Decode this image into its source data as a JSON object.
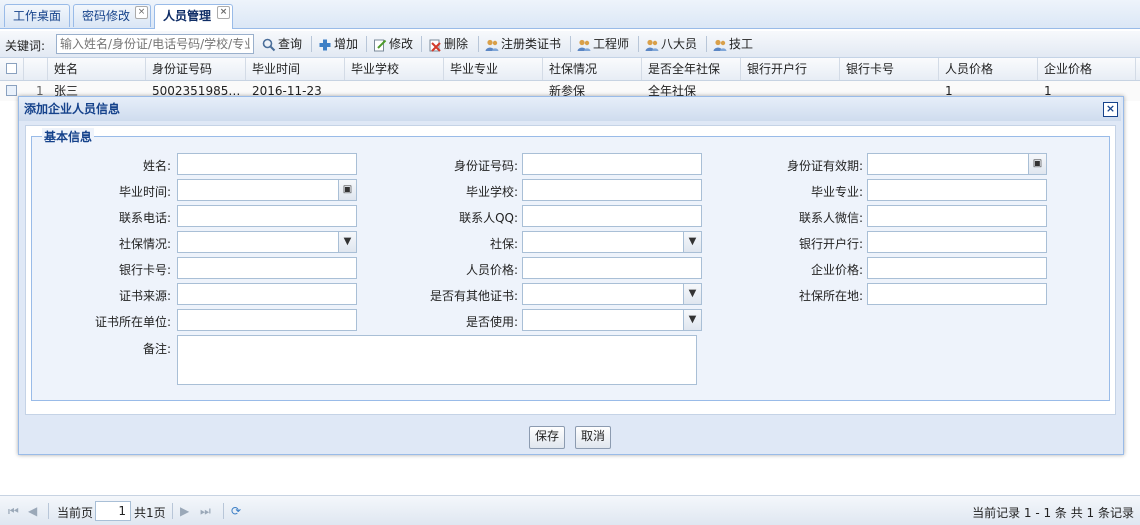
{
  "tabs": [
    {
      "label": "工作桌面"
    },
    {
      "label": "密码修改"
    },
    {
      "label": "人员管理"
    }
  ],
  "toolbar": {
    "keyword_label": "关键词:",
    "search_placeholder": "输入姓名/身份证/电话号码/学校/专业",
    "buttons": [
      {
        "label": "查询",
        "icon": "search-icon"
      },
      {
        "label": "增加",
        "icon": "add-icon"
      },
      {
        "label": "修改",
        "icon": "edit-icon"
      },
      {
        "label": "删除",
        "icon": "delete-icon"
      },
      {
        "label": "注册类证书",
        "icon": "users-icon"
      },
      {
        "label": "工程师",
        "icon": "users-icon"
      },
      {
        "label": "八大员",
        "icon": "users-icon"
      },
      {
        "label": "技工",
        "icon": "users-icon"
      }
    ]
  },
  "grid": {
    "columns": [
      "姓名",
      "身份证号码",
      "毕业时间",
      "毕业学校",
      "毕业专业",
      "社保情况",
      "是否全年社保",
      "银行开户行",
      "银行卡号",
      "人员价格",
      "企业价格"
    ],
    "rows": [
      {
        "num": "1",
        "cells": [
          "张三",
          "5002351985…",
          "2016-11-23",
          "",
          "",
          "新参保",
          "全年社保",
          "",
          "",
          "1",
          "1"
        ]
      }
    ]
  },
  "dialog": {
    "title": "添加企业人员信息",
    "legend": "基本信息",
    "fields": {
      "name": "姓名:",
      "id_number": "身份证号码:",
      "id_valid": "身份证有效期:",
      "grad_time": "毕业时间:",
      "grad_school": "毕业学校:",
      "grad_major": "毕业专业:",
      "phone": "联系电话:",
      "qq": "联系人QQ:",
      "wechat": "联系人微信:",
      "social_status": "社保情况:",
      "social": "社保:",
      "bank": "银行开户行:",
      "card": "银行卡号:",
      "person_price": "人员价格:",
      "company_price": "企业价格:",
      "cert_source": "证书来源:",
      "other_cert": "是否有其他证书:",
      "social_loc": "社保所在地:",
      "cert_unit": "证书所在单位:",
      "in_use": "是否使用:",
      "remark": "备注:"
    },
    "save": "保存",
    "cancel": "取消"
  },
  "pager": {
    "current_label": "当前页",
    "page_value": "1",
    "total_pages": "共1页",
    "summary": "当前记录 1 - 1 条 共 1 条记录"
  }
}
